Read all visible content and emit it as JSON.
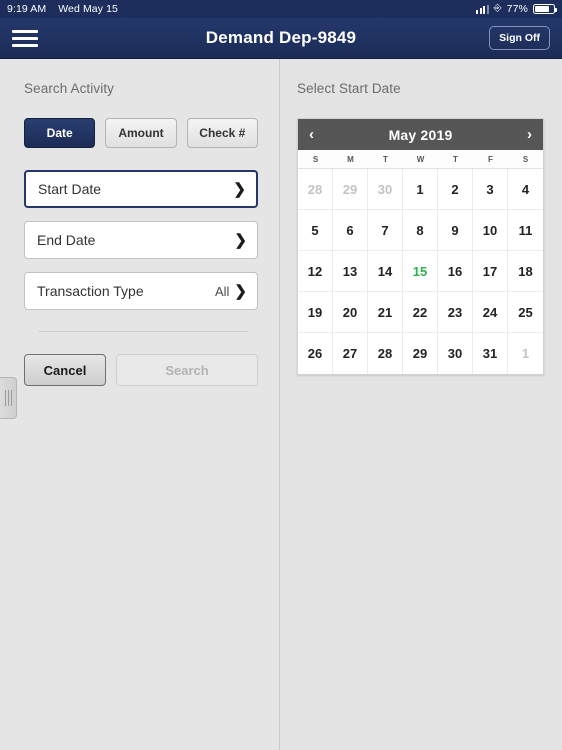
{
  "status_bar": {
    "time": "9:19 AM",
    "date": "Wed May 15",
    "battery_percent": "77%",
    "signal_icon": "signal-bars-icon",
    "orientation_lock_icon": "rotation-lock-icon",
    "battery_icon": "battery-icon"
  },
  "navbar": {
    "menu_icon": "hamburger-menu-icon",
    "title": "Demand Dep-9849",
    "sign_off_label": "Sign Off"
  },
  "left_pane": {
    "title": "Search Activity",
    "segmented": [
      {
        "label": "Date",
        "active": true
      },
      {
        "label": "Amount",
        "active": false
      },
      {
        "label": "Check #",
        "active": false
      }
    ],
    "fields": [
      {
        "label": "Start Date",
        "value": "",
        "selected": true,
        "chevron": "❯"
      },
      {
        "label": "End Date",
        "value": "",
        "selected": false,
        "chevron": "❯"
      },
      {
        "label": "Transaction Type",
        "value": "All",
        "selected": false,
        "chevron": "❯"
      }
    ],
    "cancel_label": "Cancel",
    "search_label": "Search",
    "drag_handle_icon": "drag-handle-icon"
  },
  "right_pane": {
    "title": "Select Start Date",
    "calendar": {
      "prev_icon": "‹",
      "next_icon": "›",
      "month_label": "May 2019",
      "day_headers": [
        "S",
        "M",
        "T",
        "W",
        "T",
        "F",
        "S"
      ],
      "weeks": [
        [
          {
            "d": "28",
            "state": "muted"
          },
          {
            "d": "29",
            "state": "muted"
          },
          {
            "d": "30",
            "state": "muted"
          },
          {
            "d": "1",
            "state": "normal"
          },
          {
            "d": "2",
            "state": "normal"
          },
          {
            "d": "3",
            "state": "normal"
          },
          {
            "d": "4",
            "state": "normal"
          }
        ],
        [
          {
            "d": "5",
            "state": "normal"
          },
          {
            "d": "6",
            "state": "normal"
          },
          {
            "d": "7",
            "state": "normal"
          },
          {
            "d": "8",
            "state": "normal"
          },
          {
            "d": "9",
            "state": "normal"
          },
          {
            "d": "10",
            "state": "normal"
          },
          {
            "d": "11",
            "state": "normal"
          }
        ],
        [
          {
            "d": "12",
            "state": "normal"
          },
          {
            "d": "13",
            "state": "normal"
          },
          {
            "d": "14",
            "state": "normal"
          },
          {
            "d": "15",
            "state": "today"
          },
          {
            "d": "16",
            "state": "normal"
          },
          {
            "d": "17",
            "state": "normal"
          },
          {
            "d": "18",
            "state": "normal"
          }
        ],
        [
          {
            "d": "19",
            "state": "normal"
          },
          {
            "d": "20",
            "state": "normal"
          },
          {
            "d": "21",
            "state": "normal"
          },
          {
            "d": "22",
            "state": "normal"
          },
          {
            "d": "23",
            "state": "normal"
          },
          {
            "d": "24",
            "state": "normal"
          },
          {
            "d": "25",
            "state": "normal"
          }
        ],
        [
          {
            "d": "26",
            "state": "normal"
          },
          {
            "d": "27",
            "state": "normal"
          },
          {
            "d": "28",
            "state": "normal"
          },
          {
            "d": "29",
            "state": "normal"
          },
          {
            "d": "30",
            "state": "normal"
          },
          {
            "d": "31",
            "state": "normal"
          },
          {
            "d": "1",
            "state": "muted"
          }
        ]
      ]
    }
  },
  "colors": {
    "navy": "#1c2c57",
    "calendar_header_gray": "#565656",
    "today_green": "#2bb24c",
    "page_background": "#e3e3e3"
  }
}
